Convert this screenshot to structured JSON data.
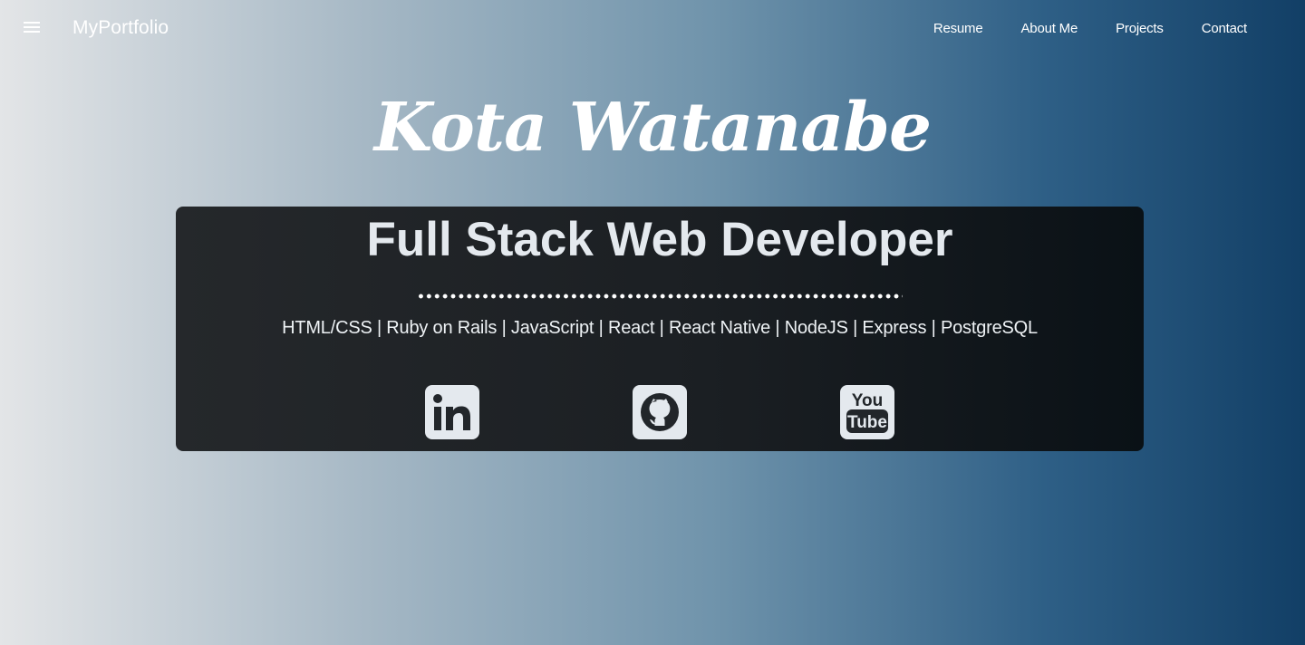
{
  "navbar": {
    "brand": "MyPortfolio",
    "menu_icon": "hamburger-menu-icon",
    "links": [
      "Resume",
      "About Me",
      "Projects",
      "Contact"
    ]
  },
  "hero": {
    "name": "Kota Watanabe",
    "title": "Full Stack Web Developer",
    "skills": "HTML/CSS | Ruby on Rails | JavaScript | React | React Native | NodeJS | Express | PostgreSQL"
  },
  "social": [
    {
      "icon": "linkedin-icon",
      "label": "in"
    },
    {
      "icon": "github-icon"
    },
    {
      "icon": "youtube-icon",
      "label_top": "You",
      "label_bottom": "Tube"
    }
  ],
  "colors": {
    "background_left": "#e3e5e7",
    "background_right": "#123f66",
    "card_background": "#1b1f23",
    "icon_tile": "#e4e9ee"
  }
}
